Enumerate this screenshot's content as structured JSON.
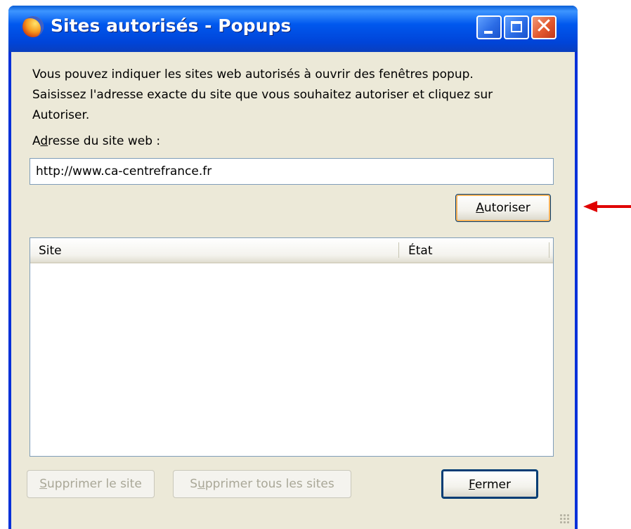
{
  "window": {
    "title": "Sites autorisés - Popups",
    "icon": "firefox-icon",
    "controls": {
      "minimize": "minimize-icon",
      "maximize": "maximize-icon",
      "close": "close-icon"
    }
  },
  "description": {
    "line1": "Vous pouvez indiquer les sites web autorisés à ouvrir des fenêtres popup.",
    "line2": "Saisissez l'adresse exacte du site que vous souhaitez autoriser et cliquez sur",
    "line3": "Autoriser."
  },
  "address": {
    "label_pre": "A",
    "label_mnemonic": "d",
    "label_post": "resse du site web :",
    "value": "http://www.ca-centrefrance.fr"
  },
  "buttons": {
    "autoriser": {
      "mnemonic": "A",
      "rest": "utoriser"
    },
    "supprimer_site": {
      "mnemonic": "S",
      "rest": "upprimer le site"
    },
    "supprimer_tous": {
      "pre": "S",
      "mnemonic": "u",
      "rest": "pprimer tous les sites"
    },
    "fermer": {
      "mnemonic": "F",
      "rest": "ermer"
    }
  },
  "list": {
    "columns": [
      "Site",
      "État"
    ],
    "rows": []
  },
  "colors": {
    "titlebar": "#0058ee",
    "dialog_bg": "#ece9d8",
    "arrow": "#e00000"
  },
  "annotation": {
    "icon": "arrow-left-icon"
  }
}
